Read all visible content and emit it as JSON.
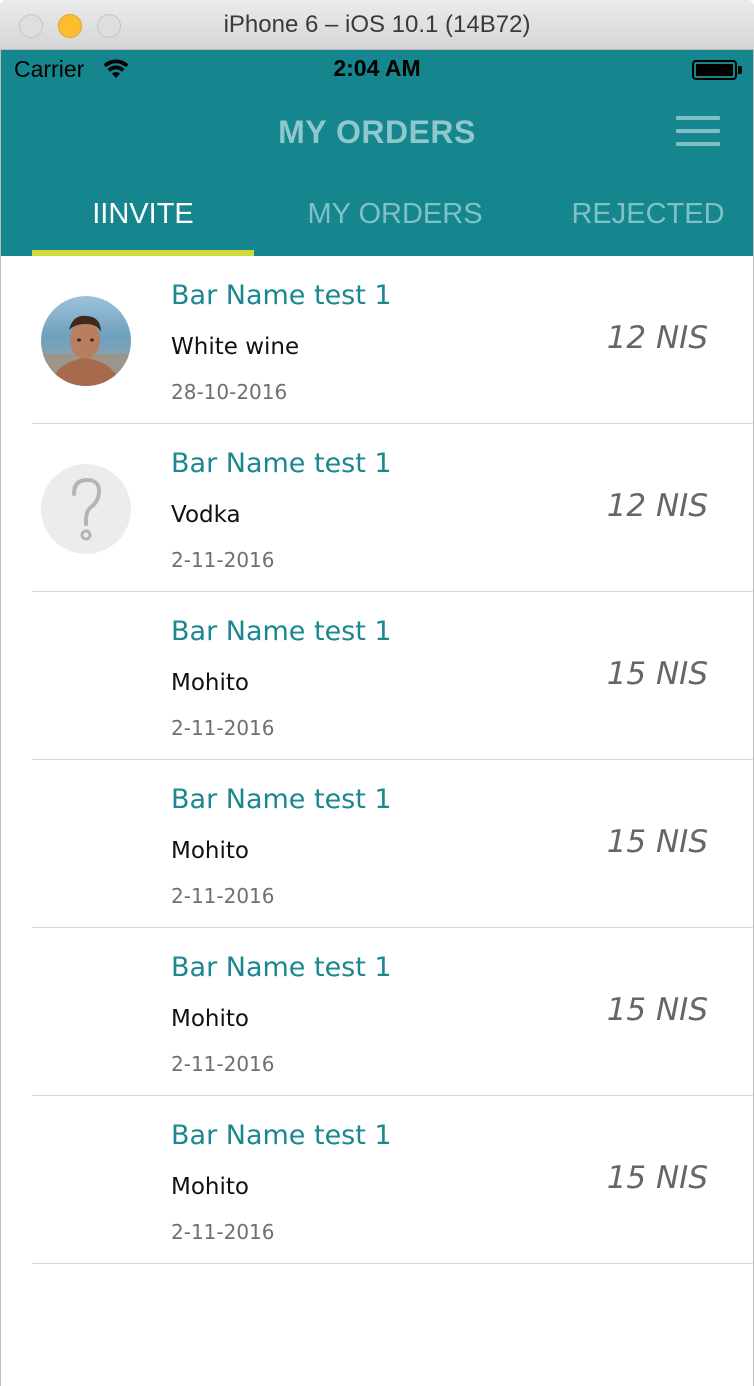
{
  "window": {
    "title": "iPhone 6 – iOS 10.1 (14B72)"
  },
  "status_bar": {
    "carrier": "Carrier",
    "time": "2:04 AM"
  },
  "header": {
    "title": "MY ORDERS",
    "menu_icon": "hamburger-menu-icon"
  },
  "tabs": [
    {
      "label": "IINVITE",
      "active": true
    },
    {
      "label": "MY ORDERS",
      "active": false
    },
    {
      "label": "REJECTED",
      "active": false
    }
  ],
  "colors": {
    "header_bg": "#15858e",
    "tab_indicator": "#cddc39",
    "bar_name": "#1b8791"
  },
  "orders": [
    {
      "bar_name": "Bar Name test 1",
      "drink": "White wine",
      "date": "28-10-2016",
      "price": "12 NIS",
      "avatar": "photo"
    },
    {
      "bar_name": "Bar Name test 1",
      "drink": "Vodka",
      "date": "2-11-2016",
      "price": "12 NIS",
      "avatar": "question-mark-placeholder"
    },
    {
      "bar_name": "Bar Name test 1",
      "drink": "Mohito",
      "date": "2-11-2016",
      "price": "15 NIS",
      "avatar": "none"
    },
    {
      "bar_name": "Bar Name test 1",
      "drink": "Mohito",
      "date": "2-11-2016",
      "price": "15 NIS",
      "avatar": "none"
    },
    {
      "bar_name": "Bar Name test 1",
      "drink": "Mohito",
      "date": "2-11-2016",
      "price": "15 NIS",
      "avatar": "none"
    },
    {
      "bar_name": "Bar Name test 1",
      "drink": "Mohito",
      "date": "2-11-2016",
      "price": "15 NIS",
      "avatar": "none"
    }
  ]
}
